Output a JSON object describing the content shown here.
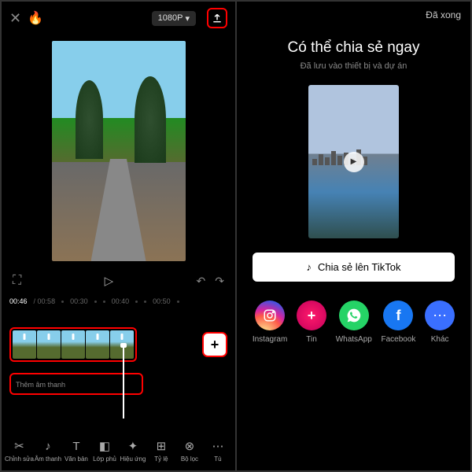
{
  "left": {
    "resolution": "1080P",
    "timecodes": {
      "current": "00:46",
      "total": "00:58",
      "marks": [
        "00:30",
        "00:40",
        "00:50"
      ]
    },
    "audio_label": "Thêm âm thanh",
    "tools": [
      {
        "icon": "✂",
        "label": "Chỉnh sửa"
      },
      {
        "icon": "♪",
        "label": "Âm thanh"
      },
      {
        "icon": "T",
        "label": "Văn bản"
      },
      {
        "icon": "◧",
        "label": "Lớp phủ"
      },
      {
        "icon": "✦",
        "label": "Hiệu ứng"
      },
      {
        "icon": "⊞",
        "label": "Tỷ lệ"
      },
      {
        "icon": "⊗",
        "label": "Bộ lọc"
      },
      {
        "icon": "⋯",
        "label": "Tù"
      }
    ]
  },
  "right": {
    "done": "Đã xong",
    "title": "Có thể chia sẻ ngay",
    "subtitle": "Đã lưu vào thiết bị và dự án",
    "tiktok_label": "Chia sẻ lên TikTok",
    "socials": [
      {
        "name": "Instagram"
      },
      {
        "name": "Tin"
      },
      {
        "name": "WhatsApp"
      },
      {
        "name": "Facebook"
      },
      {
        "name": "Khác"
      }
    ]
  }
}
